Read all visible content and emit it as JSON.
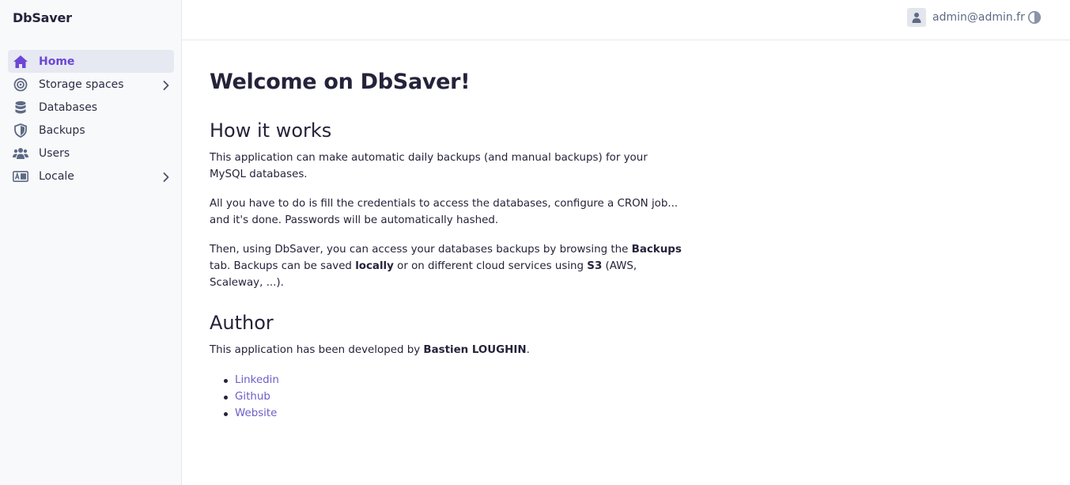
{
  "app": {
    "title": "DbSaver"
  },
  "sidebar": {
    "items": [
      {
        "label": "Home",
        "icon": "home-icon",
        "active": true
      },
      {
        "label": "Storage spaces",
        "icon": "storage-icon",
        "has_children": true
      },
      {
        "label": "Databases",
        "icon": "database-icon"
      },
      {
        "label": "Backups",
        "icon": "shield-icon"
      },
      {
        "label": "Users",
        "icon": "users-icon"
      },
      {
        "label": "Locale",
        "icon": "locale-icon",
        "has_children": true
      }
    ]
  },
  "header": {
    "user_email": "admin@admin.fr",
    "user_icon": "user-icon",
    "theme_icon": "theme-toggle-icon"
  },
  "main": {
    "title": "Welcome on DbSaver!",
    "how_it_works": {
      "heading": "How it works",
      "p1": "This application can make automatic daily backups (and manual backups) for your MySQL databases.",
      "p2": "All you have to do is fill the credentials to access the databases, configure a CRON job... and it's done. Passwords will be automatically hashed.",
      "p3_a": "Then, using DbSaver, you can access your databases backups by browsing the ",
      "p3_b": "Backups",
      "p3_c": " tab. Backups can be saved ",
      "p3_d": "locally",
      "p3_e": " or on different cloud services using ",
      "p3_f": "S3",
      "p3_g": " (AWS, Scaleway, ...)."
    },
    "author": {
      "heading": "Author",
      "intro_a": "This application has been developed by ",
      "intro_b": "Bastien LOUGHIN",
      "intro_c": ".",
      "links": [
        "Linkedin",
        "Github",
        "Website"
      ]
    }
  },
  "colors": {
    "accent": "#6c46d6",
    "link": "#6c5fc7",
    "text": "#24233a",
    "sidebar_bg": "#f8f9fb",
    "active_bg": "#e6e9f1"
  }
}
